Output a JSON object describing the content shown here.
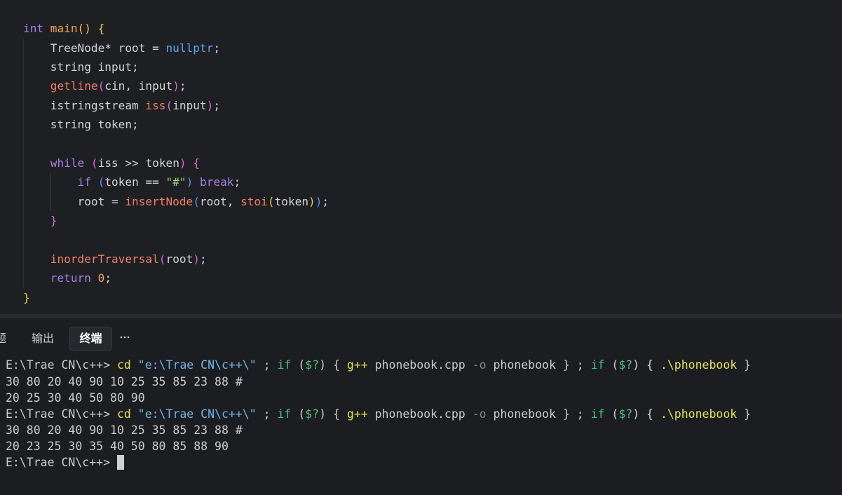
{
  "colors": {
    "editor_bg": "#1e1f23",
    "panel_bg": "#1c1d21",
    "divider": "#2a2b30",
    "code_text": "#d4d4d4",
    "keyword": "#a87fe6",
    "function_decl": "#eba24f",
    "function_call": "#ef7f63",
    "constant": "#5fa8f3",
    "string": "#a0cd7c",
    "number": "#eca065",
    "bracket_1": "#f1c63b",
    "bracket_2": "#d56bd4",
    "bracket_3": "#3e9df3",
    "tab_text": "#c8c8c8",
    "tab_active_text": "#ffffff",
    "tab_active_bg": "#27282d",
    "terminal_text": "#cccccc",
    "terminal_command": "#e6e350",
    "terminal_string": "#70b3e7",
    "terminal_keyword": "#41c47d",
    "terminal_variable": "#43c67f",
    "terminal_parameter": "#868686",
    "cursor": "#d0d0d0"
  },
  "editor": {
    "lines": [
      {
        "tokens": [
          {
            "t": "int",
            "c": "#a87fe6"
          },
          {
            "t": " "
          },
          {
            "t": "main",
            "c": "#eba24f"
          },
          {
            "t": "()",
            "c": "#f1c63b"
          },
          {
            "t": " "
          },
          {
            "t": "{",
            "c": "#f1c63b"
          }
        ]
      },
      {
        "tokens": [
          {
            "t": "    TreeNode* root = "
          },
          {
            "t": "nullptr",
            "c": "#5fa8f3"
          },
          {
            "t": ";"
          }
        ]
      },
      {
        "tokens": [
          {
            "t": "    string input;"
          }
        ]
      },
      {
        "tokens": [
          {
            "t": "    "
          },
          {
            "t": "getline",
            "c": "#ef7f63"
          },
          {
            "t": "(",
            "c": "#d56bd4"
          },
          {
            "t": "cin, input"
          },
          {
            "t": ")",
            "c": "#d56bd4"
          },
          {
            "t": ";"
          }
        ]
      },
      {
        "tokens": [
          {
            "t": "    istringstream "
          },
          {
            "t": "iss",
            "c": "#ef7f63"
          },
          {
            "t": "(",
            "c": "#d56bd4"
          },
          {
            "t": "input"
          },
          {
            "t": ")",
            "c": "#d56bd4"
          },
          {
            "t": ";"
          }
        ]
      },
      {
        "tokens": [
          {
            "t": "    string token;"
          }
        ]
      },
      {
        "tokens": []
      },
      {
        "tokens": [
          {
            "t": "    "
          },
          {
            "t": "while",
            "c": "#a87fe6"
          },
          {
            "t": " "
          },
          {
            "t": "(",
            "c": "#d56bd4"
          },
          {
            "t": "iss >> token"
          },
          {
            "t": ")",
            "c": "#d56bd4"
          },
          {
            "t": " "
          },
          {
            "t": "{",
            "c": "#d56bd4"
          }
        ]
      },
      {
        "tokens": [
          {
            "t": "        "
          },
          {
            "t": "if",
            "c": "#a87fe6"
          },
          {
            "t": " "
          },
          {
            "t": "(",
            "c": "#3e9df3"
          },
          {
            "t": "token == "
          },
          {
            "t": "\"#\"",
            "c": "#a0cd7c"
          },
          {
            "t": ")",
            "c": "#3e9df3"
          },
          {
            "t": " "
          },
          {
            "t": "break",
            "c": "#a87fe6"
          },
          {
            "t": ";"
          }
        ]
      },
      {
        "tokens": [
          {
            "t": "        root = "
          },
          {
            "t": "insertNode",
            "c": "#ef7f63"
          },
          {
            "t": "(",
            "c": "#3e9df3"
          },
          {
            "t": "root, "
          },
          {
            "t": "stoi",
            "c": "#ef7f63"
          },
          {
            "t": "(",
            "c": "#f1c63b"
          },
          {
            "t": "token"
          },
          {
            "t": ")",
            "c": "#f1c63b"
          },
          {
            "t": ")",
            "c": "#3e9df3"
          },
          {
            "t": ";"
          }
        ]
      },
      {
        "tokens": [
          {
            "t": "    "
          },
          {
            "t": "}",
            "c": "#d56bd4"
          }
        ]
      },
      {
        "tokens": []
      },
      {
        "tokens": [
          {
            "t": "    "
          },
          {
            "t": "inorderTraversal",
            "c": "#ef7f63"
          },
          {
            "t": "(",
            "c": "#d56bd4"
          },
          {
            "t": "root"
          },
          {
            "t": ")",
            "c": "#d56bd4"
          },
          {
            "t": ";"
          }
        ]
      },
      {
        "tokens": [
          {
            "t": "    "
          },
          {
            "t": "return",
            "c": "#a87fe6"
          },
          {
            "t": " "
          },
          {
            "t": "0",
            "c": "#eca065"
          },
          {
            "t": ";"
          }
        ]
      },
      {
        "tokens": [
          {
            "t": "}",
            "c": "#f1c63b"
          }
        ]
      }
    ]
  },
  "panel": {
    "tabs": [
      {
        "label": "题",
        "active": false
      },
      {
        "label": "输出",
        "active": false
      },
      {
        "label": "终端",
        "active": true
      }
    ],
    "more_icon": "more-icon"
  },
  "terminal": {
    "lines": [
      {
        "prompt": "E:\\Trae CN\\c++> ",
        "tokens": [
          {
            "t": "cd",
            "c": "#e6e350"
          },
          {
            "t": " "
          },
          {
            "t": "\"e:\\Trae CN\\c++\\\"",
            "c": "#70b3e7"
          },
          {
            "t": " ; "
          },
          {
            "t": "if",
            "c": "#41c47d"
          },
          {
            "t": " ("
          },
          {
            "t": "$?",
            "c": "#43c67f"
          },
          {
            "t": ") { "
          },
          {
            "t": "g++",
            "c": "#e6e350"
          },
          {
            "t": " phonebook.cpp "
          },
          {
            "t": "-o",
            "c": "#868686"
          },
          {
            "t": " phonebook } ; "
          },
          {
            "t": "if",
            "c": "#41c47d"
          },
          {
            "t": " ("
          },
          {
            "t": "$?",
            "c": "#43c67f"
          },
          {
            "t": ") { "
          },
          {
            "t": ".\\phonebook",
            "c": "#e6e350"
          },
          {
            "t": " }"
          }
        ]
      },
      {
        "tokens": [
          {
            "t": "30 80 20 40 90 10 25 35 85 23 88 #"
          }
        ]
      },
      {
        "tokens": [
          {
            "t": "20 25 30 40 50 80 90"
          }
        ]
      },
      {
        "prompt": "E:\\Trae CN\\c++> ",
        "tokens": [
          {
            "t": "cd",
            "c": "#e6e350"
          },
          {
            "t": " "
          },
          {
            "t": "\"e:\\Trae CN\\c++\\\"",
            "c": "#70b3e7"
          },
          {
            "t": " ; "
          },
          {
            "t": "if",
            "c": "#41c47d"
          },
          {
            "t": " ("
          },
          {
            "t": "$?",
            "c": "#43c67f"
          },
          {
            "t": ") { "
          },
          {
            "t": "g++",
            "c": "#e6e350"
          },
          {
            "t": " phonebook.cpp "
          },
          {
            "t": "-o",
            "c": "#868686"
          },
          {
            "t": " phonebook } ; "
          },
          {
            "t": "if",
            "c": "#41c47d"
          },
          {
            "t": " ("
          },
          {
            "t": "$?",
            "c": "#43c67f"
          },
          {
            "t": ") { "
          },
          {
            "t": ".\\phonebook",
            "c": "#e6e350"
          },
          {
            "t": " }"
          }
        ]
      },
      {
        "tokens": [
          {
            "t": "30 80 20 40 90 10 25 35 85 23 88 #"
          }
        ]
      },
      {
        "tokens": [
          {
            "t": "20 23 25 30 35 40 50 80 85 88 90"
          }
        ]
      },
      {
        "prompt": "E:\\Trae CN\\c++> ",
        "tokens": [],
        "cursor": true
      }
    ]
  }
}
